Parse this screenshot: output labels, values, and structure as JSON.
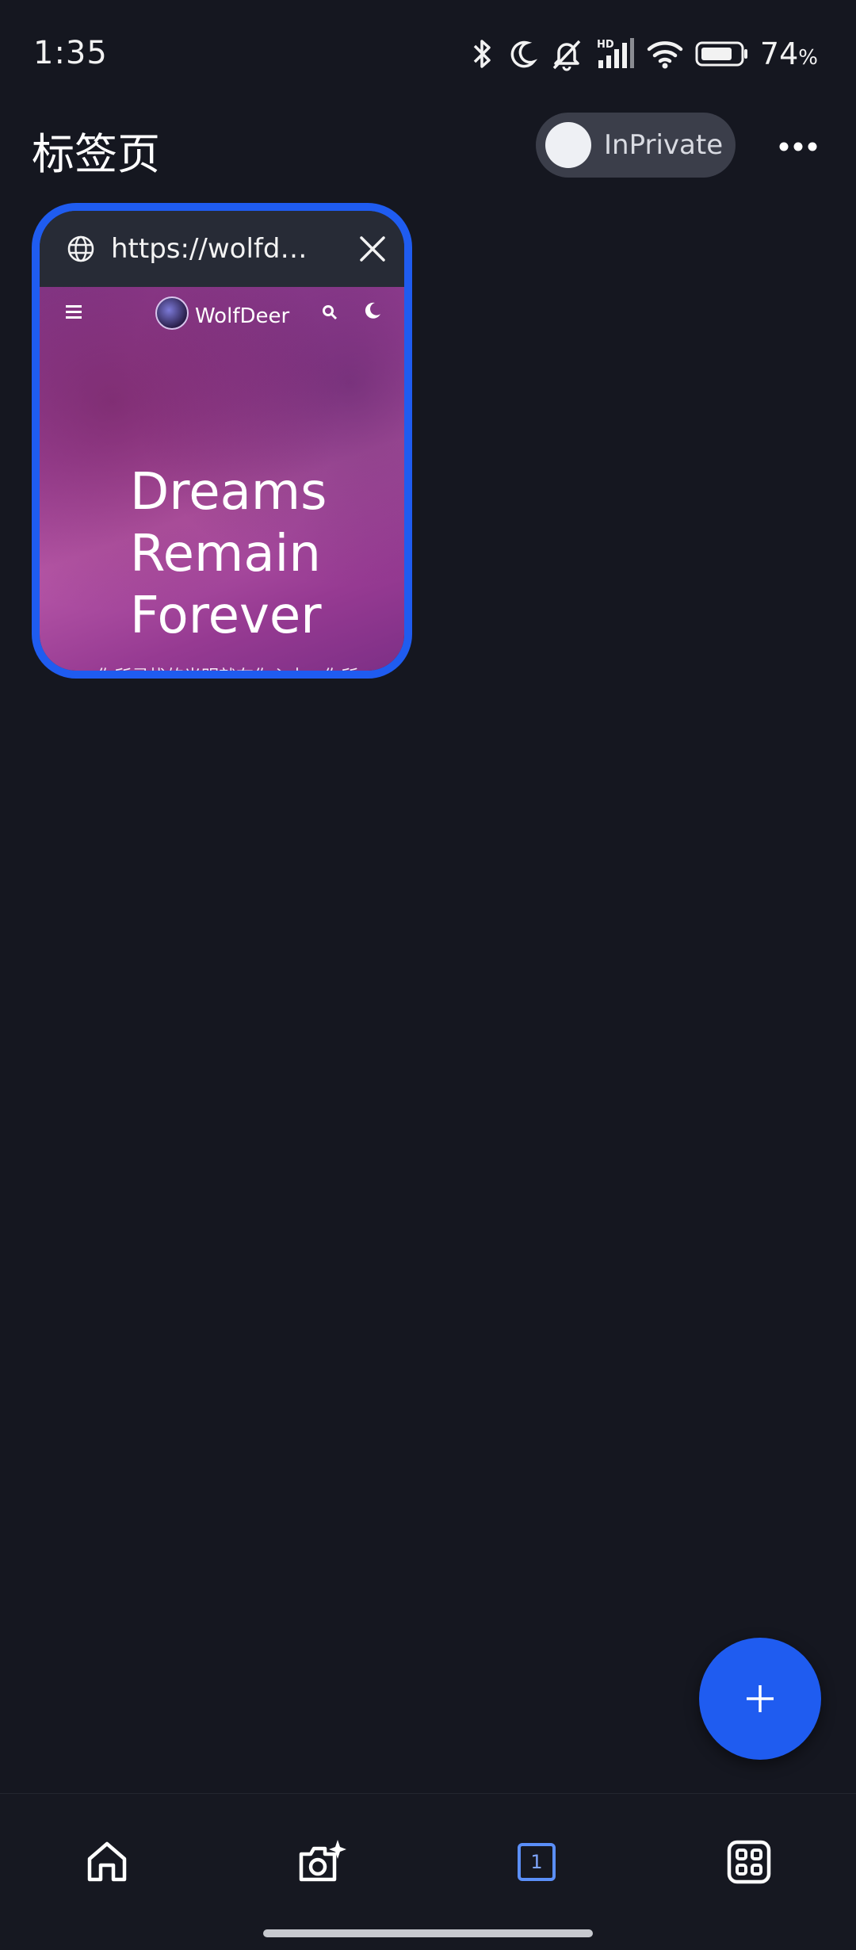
{
  "status_bar": {
    "time": "1:35",
    "battery_percent": "74",
    "battery_unit": "%",
    "icons": [
      "bluetooth-icon",
      "moon-icon",
      "mute-icon",
      "signal-hd-icon",
      "wifi-icon",
      "battery-icon"
    ]
  },
  "header": {
    "title": "标签页",
    "inprivate_label": "InPrivate",
    "inprivate_enabled": false
  },
  "tabs": [
    {
      "url": "https://wolfde...",
      "preview": {
        "site_name": "WolfDeer",
        "headline": "Dreams Remain Forever",
        "tagline": "你所寻找的光明就在你心中，你所"
      }
    }
  ],
  "bottom_nav": {
    "items": [
      "home-icon",
      "camera-sparkle-icon",
      "tabs-icon",
      "apps-icon"
    ],
    "tab_count": "1"
  },
  "colors": {
    "background": "#151720",
    "accent": "#1f5cf0",
    "tab_count_accent": "#5b8ff9"
  }
}
